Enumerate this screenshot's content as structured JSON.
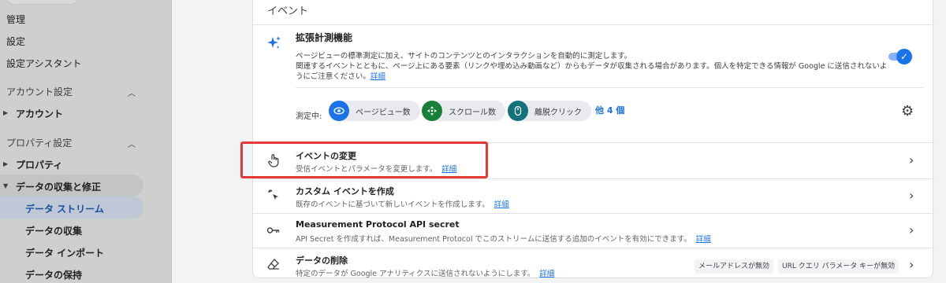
{
  "sidebar": {
    "admin": "管理",
    "settings": "設定",
    "setup_assistant": "設定アシスタント",
    "account_settings": "アカウント設定",
    "account": "アカウント",
    "property_settings": "プロパティ設定",
    "property": "プロパティ",
    "data_collection": "データの収集と修正",
    "data_streams": "データ ストリーム",
    "data_collection_item": "データの収集",
    "data_import": "データ インポート",
    "data_retention": "データの保持"
  },
  "main": {
    "section_title": "イベント",
    "enhanced_measurement": {
      "title": "拡張計測機能",
      "desc_line1": "ページビューの標準測定に加え、サイトのコンテンツとのインタラクションを自動的に測定します。",
      "desc_line2": "関連するイベントとともに、ページ上にある要素（リンクや埋め込み動画など）からもデータが収集される場合があります。個人を特定できる情報が Google に送信されないよ",
      "desc_line3": "うにご注意ください。",
      "learn_more": "詳細",
      "enabled": true,
      "measuring_label": "測定中:",
      "chips": [
        {
          "label": "ページビュー数",
          "icon": "eye-icon",
          "color": "#1a73e8"
        },
        {
          "label": "スクロール数",
          "icon": "crosshair-icon",
          "color": "#188038"
        },
        {
          "label": "離脱クリック",
          "icon": "mouse-icon",
          "color": "#12737a"
        }
      ],
      "more": "他 4 個"
    },
    "rows": [
      {
        "title": "イベントの変更",
        "desc": "受信イベントとパラメータを変更します。",
        "link": "詳細",
        "icon": "touch-icon"
      },
      {
        "title": "カスタム イベントを作成",
        "desc": "既存のイベントに基づいて新しいイベントを作成します。",
        "link": "詳細",
        "icon": "sparkle-cursor-icon"
      },
      {
        "title": "Measurement Protocol API secret",
        "desc": "API Secret を作成すれば、Measurement Protocol でこのストリームに送信する追加のイベントを有効にできます。",
        "link": "詳細",
        "icon": "key-icon"
      },
      {
        "title": "データの削除",
        "desc": "特定のデータが Google アナリティクスに送信されないようにします。",
        "link": "詳細",
        "icon": "eraser-icon"
      }
    ],
    "tags": [
      "メールアドレスが無効",
      "URL クエリ パラメータ キーが無効"
    ]
  },
  "colors": {
    "accent": "#1a73e8",
    "highlight": "#e53935"
  }
}
